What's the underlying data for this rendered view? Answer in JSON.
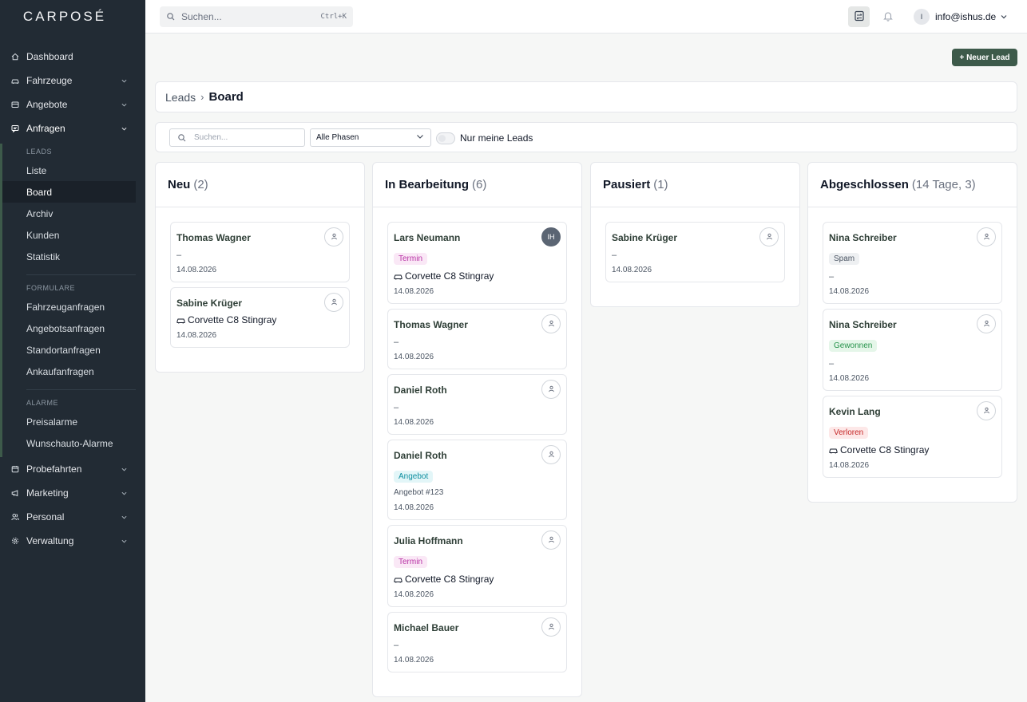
{
  "app": {
    "logo": "CARPOSÉ"
  },
  "colors": {
    "sidebar_bg": "#222b34",
    "accent": "#3d5a4a"
  },
  "sidebar": {
    "dashboard": "Dashboard",
    "fahrzeuge": "Fahrzeuge",
    "angebote": "Angebote",
    "anfragen": "Anfragen",
    "leads_head": "LEADS",
    "liste": "Liste",
    "board": "Board",
    "archiv": "Archiv",
    "kunden": "Kunden",
    "statistik": "Statistik",
    "formulare_head": "FORMULARE",
    "fahrzeuganfragen": "Fahrzeuganfragen",
    "angebotsanfragen": "Angebotsanfragen",
    "standortanfragen": "Standortanfragen",
    "ankaufanfragen": "Ankaufanfragen",
    "alarme_head": "ALARME",
    "preisalarme": "Preisalarme",
    "wunschauto": "Wunschauto-Alarme",
    "probefahrten": "Probefahrten",
    "marketing": "Marketing",
    "personal": "Personal",
    "verwaltung": "Verwaltung"
  },
  "topbar": {
    "search_placeholder": "Suchen...",
    "shortcut": "Ctrl+K",
    "user_initial": "I",
    "user_email": "info@ishus.de"
  },
  "actions": {
    "new_lead": "+ Neuer Lead"
  },
  "breadcrumb": {
    "parent": "Leads",
    "sep": "›",
    "current": "Board"
  },
  "filters": {
    "search_placeholder": "Suchen...",
    "phase_value": "Alle Phasen",
    "only_mine": "Nur meine Leads"
  },
  "columns": [
    {
      "title": "Neu",
      "count": "(2)",
      "cards": [
        {
          "name": "Thomas Wagner",
          "dash": "–",
          "date": "14.08.2026"
        },
        {
          "name": "Sabine Krüger",
          "vehicle": "Corvette C8 Stingray",
          "date": "14.08.2026"
        }
      ]
    },
    {
      "title": "In Bearbeitung",
      "count": "(6)",
      "cards": [
        {
          "name": "Lars Neumann",
          "initials": "IH",
          "badge": "Termin",
          "vehicle": "Corvette C8 Stingray",
          "date": "14.08.2026"
        },
        {
          "name": "Thomas Wagner",
          "dash": "–",
          "date": "14.08.2026"
        },
        {
          "name": "Daniel Roth",
          "dash": "–",
          "date": "14.08.2026"
        },
        {
          "name": "Daniel Roth",
          "badge": "Angebot",
          "sub": "Angebot #123",
          "date": "14.08.2026"
        },
        {
          "name": "Julia Hoffmann",
          "badge": "Termin",
          "vehicle": "Corvette C8 Stingray",
          "date": "14.08.2026"
        },
        {
          "name": "Michael Bauer",
          "dash": "–",
          "date": "14.08.2026"
        }
      ]
    },
    {
      "title": "Pausiert",
      "count": "(1)",
      "cards": [
        {
          "name": "Sabine Krüger",
          "dash": "–",
          "date": "14.08.2026"
        }
      ]
    },
    {
      "title": "Abgeschlossen",
      "count": "(14 Tage, 3)",
      "cards": [
        {
          "name": "Nina Schreiber",
          "badge": "Spam",
          "dash": "–",
          "date": "14.08.2026"
        },
        {
          "name": "Nina Schreiber",
          "badge": "Gewonnen",
          "dash": "–",
          "date": "14.08.2026"
        },
        {
          "name": "Kevin Lang",
          "badge": "Verloren",
          "vehicle": "Corvette C8 Stingray",
          "date": "14.08.2026"
        }
      ]
    }
  ]
}
